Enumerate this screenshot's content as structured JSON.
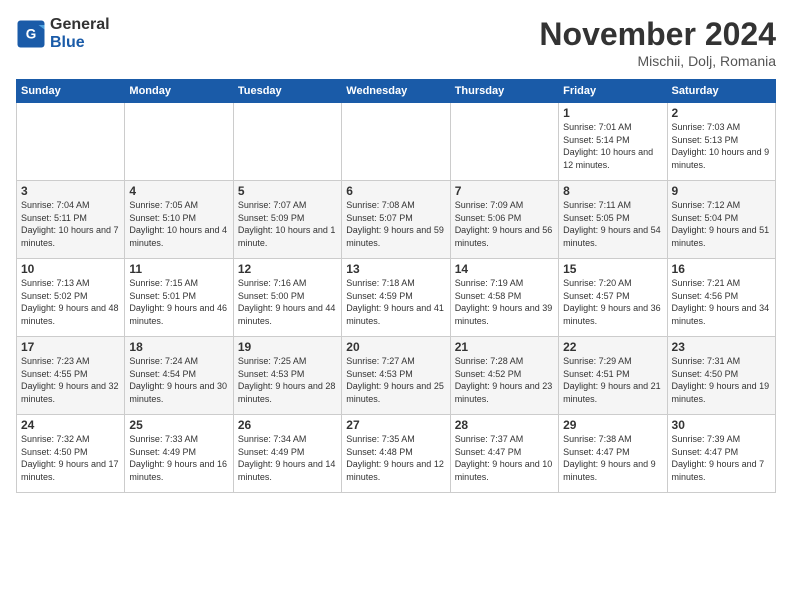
{
  "logo": {
    "general": "General",
    "blue": "Blue"
  },
  "title": "November 2024",
  "location": "Mischii, Dolj, Romania",
  "days_of_week": [
    "Sunday",
    "Monday",
    "Tuesday",
    "Wednesday",
    "Thursday",
    "Friday",
    "Saturday"
  ],
  "weeks": [
    [
      {
        "day": "",
        "info": ""
      },
      {
        "day": "",
        "info": ""
      },
      {
        "day": "",
        "info": ""
      },
      {
        "day": "",
        "info": ""
      },
      {
        "day": "",
        "info": ""
      },
      {
        "day": "1",
        "info": "Sunrise: 7:01 AM\nSunset: 5:14 PM\nDaylight: 10 hours\nand 12 minutes."
      },
      {
        "day": "2",
        "info": "Sunrise: 7:03 AM\nSunset: 5:13 PM\nDaylight: 10 hours\nand 9 minutes."
      }
    ],
    [
      {
        "day": "3",
        "info": "Sunrise: 7:04 AM\nSunset: 5:11 PM\nDaylight: 10 hours\nand 7 minutes."
      },
      {
        "day": "4",
        "info": "Sunrise: 7:05 AM\nSunset: 5:10 PM\nDaylight: 10 hours\nand 4 minutes."
      },
      {
        "day": "5",
        "info": "Sunrise: 7:07 AM\nSunset: 5:09 PM\nDaylight: 10 hours\nand 1 minute."
      },
      {
        "day": "6",
        "info": "Sunrise: 7:08 AM\nSunset: 5:07 PM\nDaylight: 9 hours\nand 59 minutes."
      },
      {
        "day": "7",
        "info": "Sunrise: 7:09 AM\nSunset: 5:06 PM\nDaylight: 9 hours\nand 56 minutes."
      },
      {
        "day": "8",
        "info": "Sunrise: 7:11 AM\nSunset: 5:05 PM\nDaylight: 9 hours\nand 54 minutes."
      },
      {
        "day": "9",
        "info": "Sunrise: 7:12 AM\nSunset: 5:04 PM\nDaylight: 9 hours\nand 51 minutes."
      }
    ],
    [
      {
        "day": "10",
        "info": "Sunrise: 7:13 AM\nSunset: 5:02 PM\nDaylight: 9 hours\nand 48 minutes."
      },
      {
        "day": "11",
        "info": "Sunrise: 7:15 AM\nSunset: 5:01 PM\nDaylight: 9 hours\nand 46 minutes."
      },
      {
        "day": "12",
        "info": "Sunrise: 7:16 AM\nSunset: 5:00 PM\nDaylight: 9 hours\nand 44 minutes."
      },
      {
        "day": "13",
        "info": "Sunrise: 7:18 AM\nSunset: 4:59 PM\nDaylight: 9 hours\nand 41 minutes."
      },
      {
        "day": "14",
        "info": "Sunrise: 7:19 AM\nSunset: 4:58 PM\nDaylight: 9 hours\nand 39 minutes."
      },
      {
        "day": "15",
        "info": "Sunrise: 7:20 AM\nSunset: 4:57 PM\nDaylight: 9 hours\nand 36 minutes."
      },
      {
        "day": "16",
        "info": "Sunrise: 7:21 AM\nSunset: 4:56 PM\nDaylight: 9 hours\nand 34 minutes."
      }
    ],
    [
      {
        "day": "17",
        "info": "Sunrise: 7:23 AM\nSunset: 4:55 PM\nDaylight: 9 hours\nand 32 minutes."
      },
      {
        "day": "18",
        "info": "Sunrise: 7:24 AM\nSunset: 4:54 PM\nDaylight: 9 hours\nand 30 minutes."
      },
      {
        "day": "19",
        "info": "Sunrise: 7:25 AM\nSunset: 4:53 PM\nDaylight: 9 hours\nand 28 minutes."
      },
      {
        "day": "20",
        "info": "Sunrise: 7:27 AM\nSunset: 4:53 PM\nDaylight: 9 hours\nand 25 minutes."
      },
      {
        "day": "21",
        "info": "Sunrise: 7:28 AM\nSunset: 4:52 PM\nDaylight: 9 hours\nand 23 minutes."
      },
      {
        "day": "22",
        "info": "Sunrise: 7:29 AM\nSunset: 4:51 PM\nDaylight: 9 hours\nand 21 minutes."
      },
      {
        "day": "23",
        "info": "Sunrise: 7:31 AM\nSunset: 4:50 PM\nDaylight: 9 hours\nand 19 minutes."
      }
    ],
    [
      {
        "day": "24",
        "info": "Sunrise: 7:32 AM\nSunset: 4:50 PM\nDaylight: 9 hours\nand 17 minutes."
      },
      {
        "day": "25",
        "info": "Sunrise: 7:33 AM\nSunset: 4:49 PM\nDaylight: 9 hours\nand 16 minutes."
      },
      {
        "day": "26",
        "info": "Sunrise: 7:34 AM\nSunset: 4:49 PM\nDaylight: 9 hours\nand 14 minutes."
      },
      {
        "day": "27",
        "info": "Sunrise: 7:35 AM\nSunset: 4:48 PM\nDaylight: 9 hours\nand 12 minutes."
      },
      {
        "day": "28",
        "info": "Sunrise: 7:37 AM\nSunset: 4:47 PM\nDaylight: 9 hours\nand 10 minutes."
      },
      {
        "day": "29",
        "info": "Sunrise: 7:38 AM\nSunset: 4:47 PM\nDaylight: 9 hours\nand 9 minutes."
      },
      {
        "day": "30",
        "info": "Sunrise: 7:39 AM\nSunset: 4:47 PM\nDaylight: 9 hours\nand 7 minutes."
      }
    ]
  ]
}
